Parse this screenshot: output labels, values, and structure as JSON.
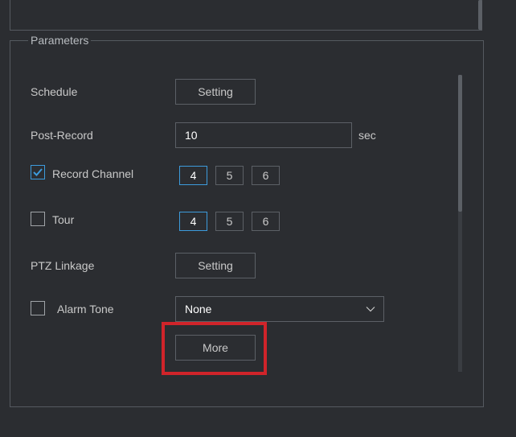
{
  "parameters": {
    "legend": "Parameters",
    "schedule": {
      "label": "Schedule",
      "button": "Setting"
    },
    "post_record": {
      "label": "Post-Record",
      "value": "10",
      "unit": "sec"
    },
    "record_channel": {
      "label": "Record Channel",
      "checked": true,
      "channels": [
        "4",
        "5",
        "6"
      ],
      "selected": "4"
    },
    "tour": {
      "label": "Tour",
      "checked": false,
      "channels": [
        "4",
        "5",
        "6"
      ],
      "selected": "4"
    },
    "ptz_linkage": {
      "label": "PTZ Linkage",
      "button": "Setting"
    },
    "alarm_tone": {
      "label": "Alarm Tone",
      "checked": false,
      "value": "None"
    },
    "more_button": "More"
  },
  "colors": {
    "background": "#2b2d31",
    "accent": "#3d9bdc",
    "highlight": "#d0242a",
    "border": "#5c6066"
  },
  "icons": {
    "checkmark": "checkmark-icon",
    "dropdown": "chevron-down-icon"
  }
}
